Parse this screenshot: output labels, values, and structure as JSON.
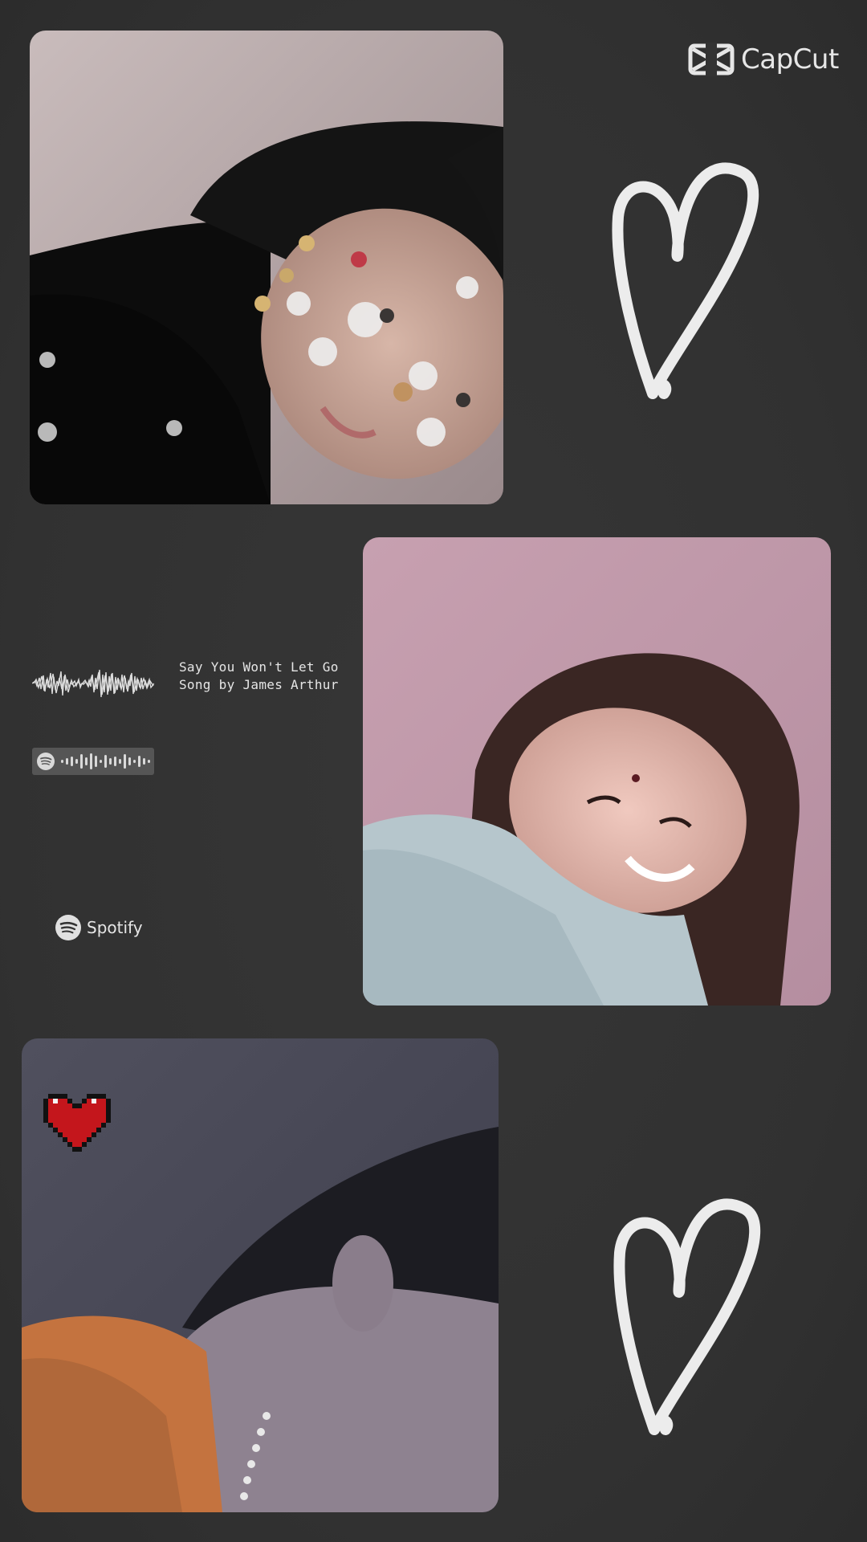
{
  "watermark": {
    "brand": "CapCut",
    "icon": "capcut-logo-icon"
  },
  "song": {
    "title": "Say You Won't Let Go",
    "artist": "Song by James Arthur"
  },
  "spotify": {
    "label": "Spotify",
    "icon": "spotify-logo-icon"
  },
  "colors": {
    "background": "#333333",
    "heart_stroke": "#ececec",
    "pixel_heart": "#c4161c"
  },
  "photos": [
    {
      "id": "photo-1",
      "description_icon": "selfie-photo"
    },
    {
      "id": "photo-2",
      "description_icon": "smiling-photo"
    },
    {
      "id": "photo-3",
      "description_icon": "profile-photo"
    }
  ]
}
